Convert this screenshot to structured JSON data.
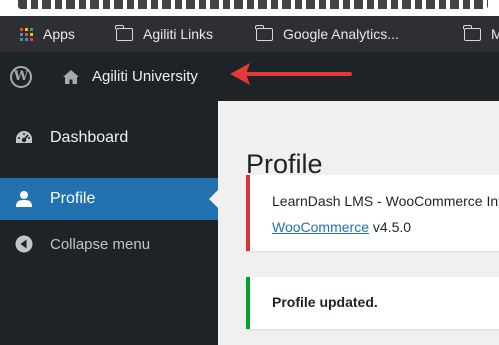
{
  "bookmarks": {
    "apps_label": "Apps",
    "items": [
      {
        "label": "Agiliti Links"
      },
      {
        "label": "Google Analytics..."
      },
      {
        "label": "M"
      }
    ],
    "apps_colors": [
      "#ea4335",
      "#fbbc05",
      "#34a853",
      "#4285f4",
      "#ea4335",
      "#fbbc05",
      "#34a853",
      "#4285f4",
      "#ea4335"
    ]
  },
  "adminbar": {
    "site_name": "Agiliti University",
    "logo_glyph": "W",
    "arrow_color": "#e53935"
  },
  "sidebar": {
    "items": [
      {
        "label": "Dashboard",
        "icon": "dashboard-icon"
      },
      {
        "label": "Profile",
        "icon": "user-icon",
        "current": true
      },
      {
        "label": "Collapse menu",
        "icon": "collapse-icon"
      }
    ]
  },
  "main": {
    "page_title": "Profile",
    "error_notice": {
      "line1": "LearnDash LMS - WooCommerce Integration requires",
      "link_text": "WooCommerce",
      "line2_suffix": " v4.5.0"
    },
    "success_notice": {
      "text": "Profile updated."
    }
  },
  "colors": {
    "admin_bg": "#1d2327",
    "accent": "#2271b1",
    "error_border": "#d63638",
    "success_border": "#00a32a",
    "content_bg": "#f0f0f1"
  }
}
